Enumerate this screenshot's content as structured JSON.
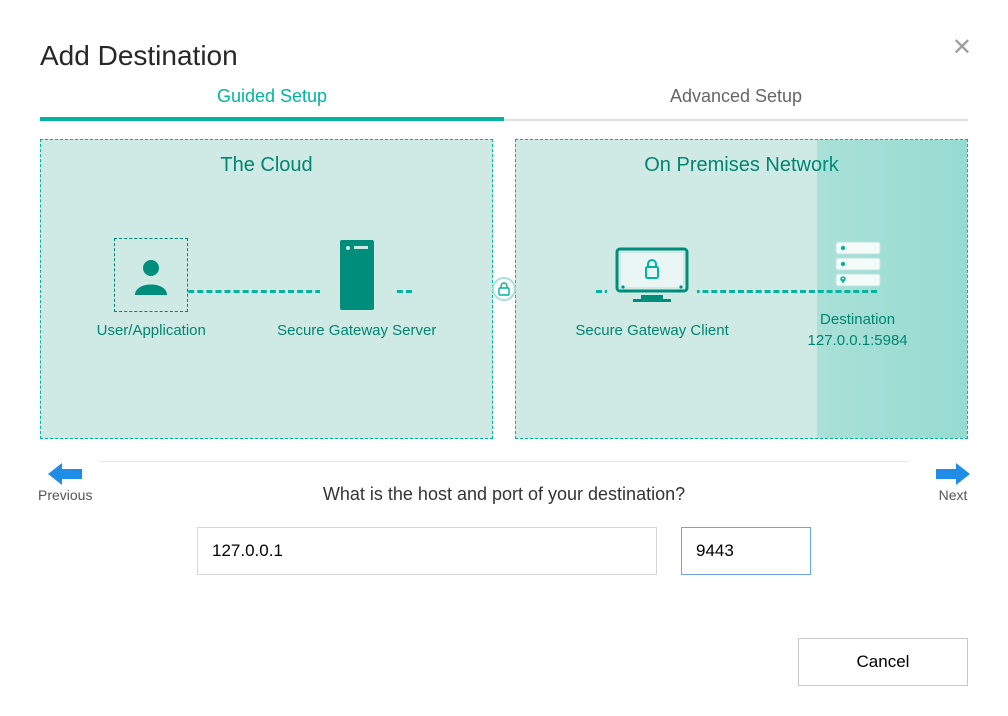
{
  "title": "Add Destination",
  "tabs": {
    "guided": "Guided Setup",
    "advanced": "Advanced Setup"
  },
  "panels": {
    "cloud_title": "The Cloud",
    "onprem_title": "On Premises Network"
  },
  "nodes": {
    "user_app": "User/Application",
    "sg_server": "Secure Gateway Server",
    "sg_client": "Secure Gateway Client",
    "destination": "Destination\n127.0.0.1:5984"
  },
  "step": {
    "previous": "Previous",
    "next": "Next",
    "question": "What is the host and port of your destination?"
  },
  "inputs": {
    "host_value": "127.0.0.1",
    "port_value": "9443"
  },
  "actions": {
    "cancel": "Cancel"
  },
  "icons": {
    "close": "✕"
  }
}
